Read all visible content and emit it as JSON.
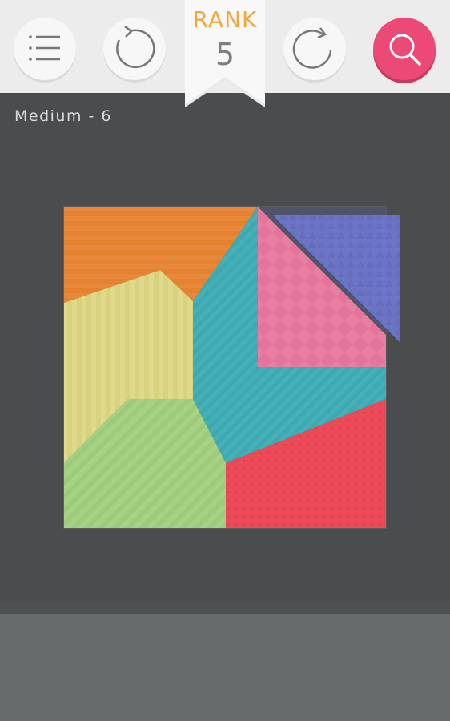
{
  "toolbar": {
    "menu_icon": "list-icon",
    "undo_icon": "undo-icon",
    "reset_icon": "reset-icon",
    "search_icon": "search-icon",
    "search_color": "#ec4a76"
  },
  "rank": {
    "label": "RANK",
    "value": "5",
    "label_color": "#f3a73b"
  },
  "level": {
    "title": "Medium - 6"
  },
  "puzzle": {
    "pieces": [
      {
        "name": "orange",
        "color": "#e8883a"
      },
      {
        "name": "yellow",
        "color": "#dfd98b"
      },
      {
        "name": "teal",
        "color": "#45b0b8"
      },
      {
        "name": "pink",
        "color": "#e97ea5"
      },
      {
        "name": "blue",
        "color": "#6c74c6"
      },
      {
        "name": "green",
        "color": "#a6d383"
      },
      {
        "name": "red",
        "color": "#ec4a58"
      }
    ]
  }
}
